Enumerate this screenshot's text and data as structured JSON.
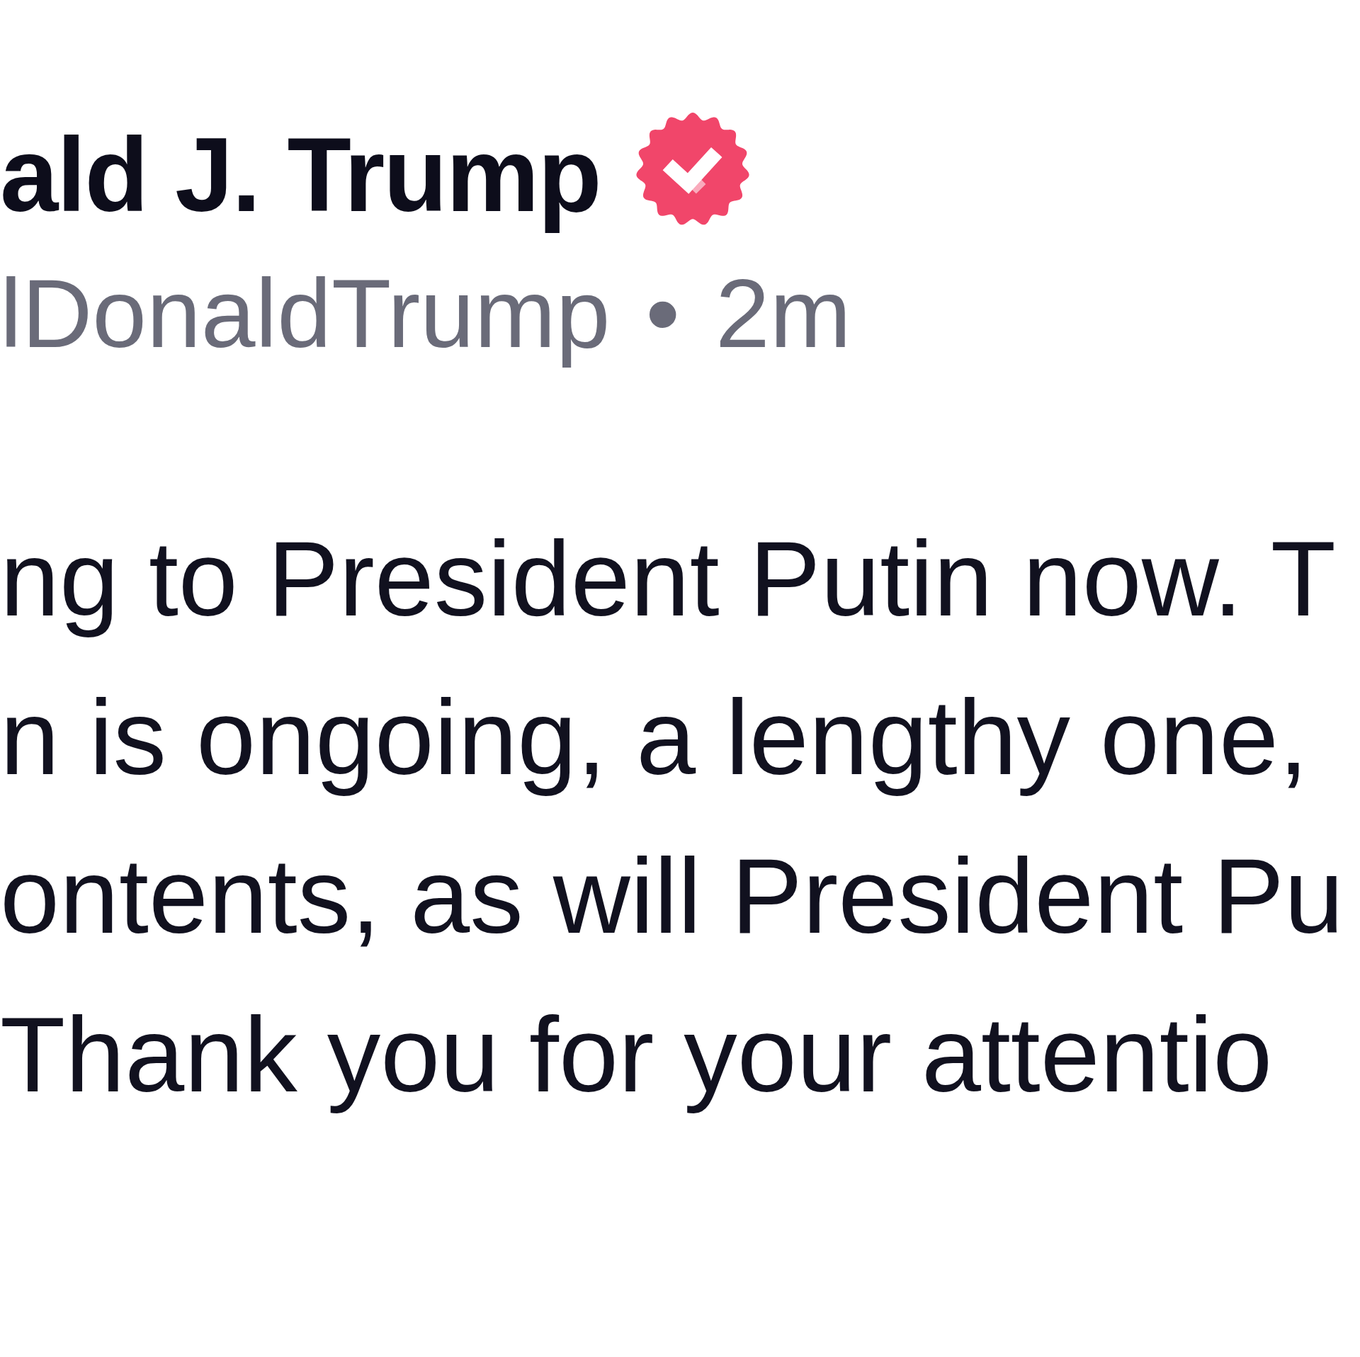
{
  "post": {
    "author_name": "ald J. Trump",
    "verified": true,
    "handle": "lDonaldTrump",
    "separator": "•",
    "time": "2m",
    "body_lines": [
      "ng to President Putin now. T",
      "n is ongoing, a lengthy one,",
      "ontents, as will President Pu",
      "Thank you for your attentio"
    ]
  }
}
